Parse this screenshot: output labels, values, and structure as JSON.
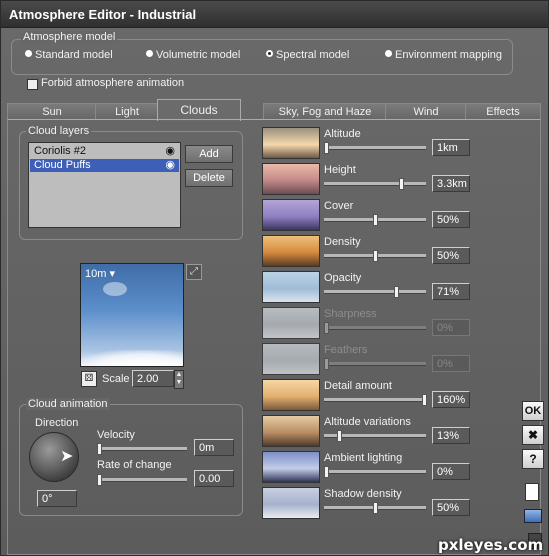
{
  "window": {
    "title": "Atmosphere Editor - Industrial"
  },
  "atmosphere_model": {
    "legend": "Atmosphere model",
    "options": [
      "Standard model",
      "Volumetric model",
      "Spectral model",
      "Environment mapping"
    ],
    "selected": "Spectral model"
  },
  "forbid_animation": {
    "label": "Forbid atmosphere animation",
    "checked": false
  },
  "tabs": [
    "Sun",
    "Light",
    "Clouds",
    "Sky, Fog and Haze",
    "Wind",
    "Effects"
  ],
  "active_tab": "Clouds",
  "cloud_layers": {
    "legend": "Cloud layers",
    "items": [
      "Coriolis #2",
      "Cloud Puffs"
    ],
    "selected": "Cloud Puffs",
    "add_label": "Add",
    "delete_label": "Delete"
  },
  "preview": {
    "altitude_label": "10m",
    "scale_label": "Scale",
    "scale_value": "2.00"
  },
  "cloud_animation": {
    "legend": "Cloud animation",
    "direction_label": "Direction",
    "direction_value": "0°",
    "velocity_label": "Velocity",
    "velocity_value": "0m",
    "rate_label": "Rate of change",
    "rate_value": "0.00"
  },
  "params": [
    {
      "label": "Altitude",
      "value": "1km",
      "level": 0.0,
      "enabled": true
    },
    {
      "label": "Height",
      "value": "3.3km",
      "level": 0.77,
      "enabled": true
    },
    {
      "label": "Cover",
      "value": "50%",
      "level": 0.5,
      "enabled": true
    },
    {
      "label": "Density",
      "value": "50%",
      "level": 0.5,
      "enabled": true
    },
    {
      "label": "Opacity",
      "value": "71%",
      "level": 0.71,
      "enabled": true
    },
    {
      "label": "Sharpness",
      "value": "0%",
      "level": 0.0,
      "enabled": false
    },
    {
      "label": "Feathers",
      "value": "0%",
      "level": 0.0,
      "enabled": false
    },
    {
      "label": "Detail amount",
      "value": "160%",
      "level": 1.0,
      "enabled": true
    },
    {
      "label": "Altitude variations",
      "value": "13%",
      "level": 0.13,
      "enabled": true
    },
    {
      "label": "Ambient lighting",
      "value": "0%",
      "level": 0.0,
      "enabled": true
    },
    {
      "label": "Shadow density",
      "value": "50%",
      "level": 0.5,
      "enabled": true
    }
  ],
  "side_buttons": {
    "ok": "OK",
    "cancel": "✖",
    "help": "?"
  },
  "watermark": "pxleyes.com"
}
